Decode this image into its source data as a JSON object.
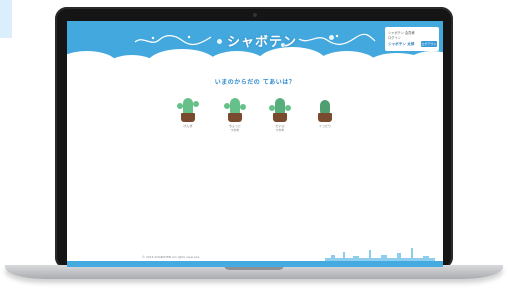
{
  "header": {
    "logo": "シャボテン",
    "login": {
      "line1": "シャボテン 会員様",
      "line2": "ログイン",
      "user": "シャボテン 太郎",
      "button": "ログアウト"
    }
  },
  "question": "いまのからだの てあいは？",
  "cacti": [
    {
      "label": "げんき"
    },
    {
      "label": "ちょっと\nつかれ"
    },
    {
      "label": "だいぶ\nつかれ"
    },
    {
      "label": "ぐったり"
    }
  ],
  "footer": {
    "copyright": "© 2016 SHABOTEN all rights reserved."
  },
  "colors": {
    "header_blue": "#43a8de",
    "cactus_green": "#66c08a",
    "pot_brown": "#7a4a2e",
    "question_blue": "#2f8bd0"
  }
}
